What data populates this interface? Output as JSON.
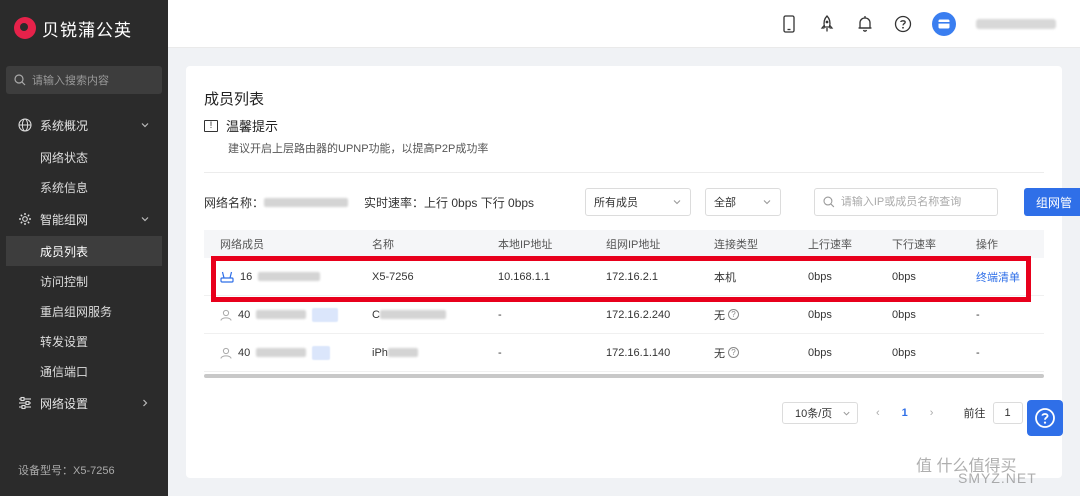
{
  "brand": {
    "name": "贝锐蒲公英"
  },
  "sidebar": {
    "search_placeholder": "请输入搜索内容",
    "groups": [
      {
        "label": "系统概况",
        "icon": "globe-icon",
        "expanded": true,
        "items": [
          "网络状态",
          "系统信息"
        ]
      },
      {
        "label": "智能组网",
        "icon": "network-gear-icon",
        "expanded": true,
        "items": [
          "成员列表",
          "访问控制",
          "重启组网服务",
          "转发设置",
          "通信端口"
        ]
      },
      {
        "label": "网络设置",
        "icon": "sliders-icon",
        "expanded": false,
        "items": []
      }
    ],
    "active_item": "成员列表",
    "device_model": "设备型号：X5-7256"
  },
  "topbar": {
    "icons": [
      "phone-icon",
      "rocket-icon",
      "bell-icon",
      "help-icon"
    ]
  },
  "page": {
    "title": "成员列表",
    "tip_title": "温馨提示",
    "tip_text": "建议开启上层路由器的UPNP功能，以提高P2P成功率",
    "network_name_label": "网络名称：",
    "speed_text": "实时速率：上行 0bps 下行 0bps",
    "member_filter": "所有成员",
    "status_filter": "全部",
    "search_placeholder": "请输入IP或成员名称查询",
    "primary_button": "组网管"
  },
  "table": {
    "columns": [
      "网络成员",
      "名称",
      "本地IP地址",
      "组网IP地址",
      "连接类型",
      "上行速率",
      "下行速率",
      "操作"
    ],
    "rows": [
      {
        "member_prefix": "16",
        "name": "X5-7256",
        "local_ip": "10.168.1.1",
        "net_ip": "172.16.2.1",
        "conn": "本机",
        "up": "0bps",
        "down": "0bps",
        "action": "终端清单",
        "has_help": false,
        "icon": "router-icon"
      },
      {
        "member_prefix": "40",
        "name": "C",
        "local_ip": "-",
        "net_ip": "172.16.2.240",
        "conn": "无",
        "up": "0bps",
        "down": "0bps",
        "action": "-",
        "has_help": true,
        "icon": "user-icon"
      },
      {
        "member_prefix": "40",
        "name": "iPh",
        "local_ip": "-",
        "net_ip": "172.16.1.140",
        "conn": "无",
        "up": "0bps",
        "down": "0bps",
        "action": "-",
        "has_help": true,
        "icon": "user-icon"
      }
    ]
  },
  "pagination": {
    "page_size": "10条/页",
    "current_page": "1",
    "goto_label": "前往",
    "goto_value": "1"
  },
  "watermark": {
    "text": "值 什么值得买",
    "site": "SMYZ.NET"
  },
  "colors": {
    "accent": "#2f6fe8",
    "sidebar_bg": "#2b2b2b",
    "highlight": "#e8001c",
    "brand": "#e6224a"
  }
}
